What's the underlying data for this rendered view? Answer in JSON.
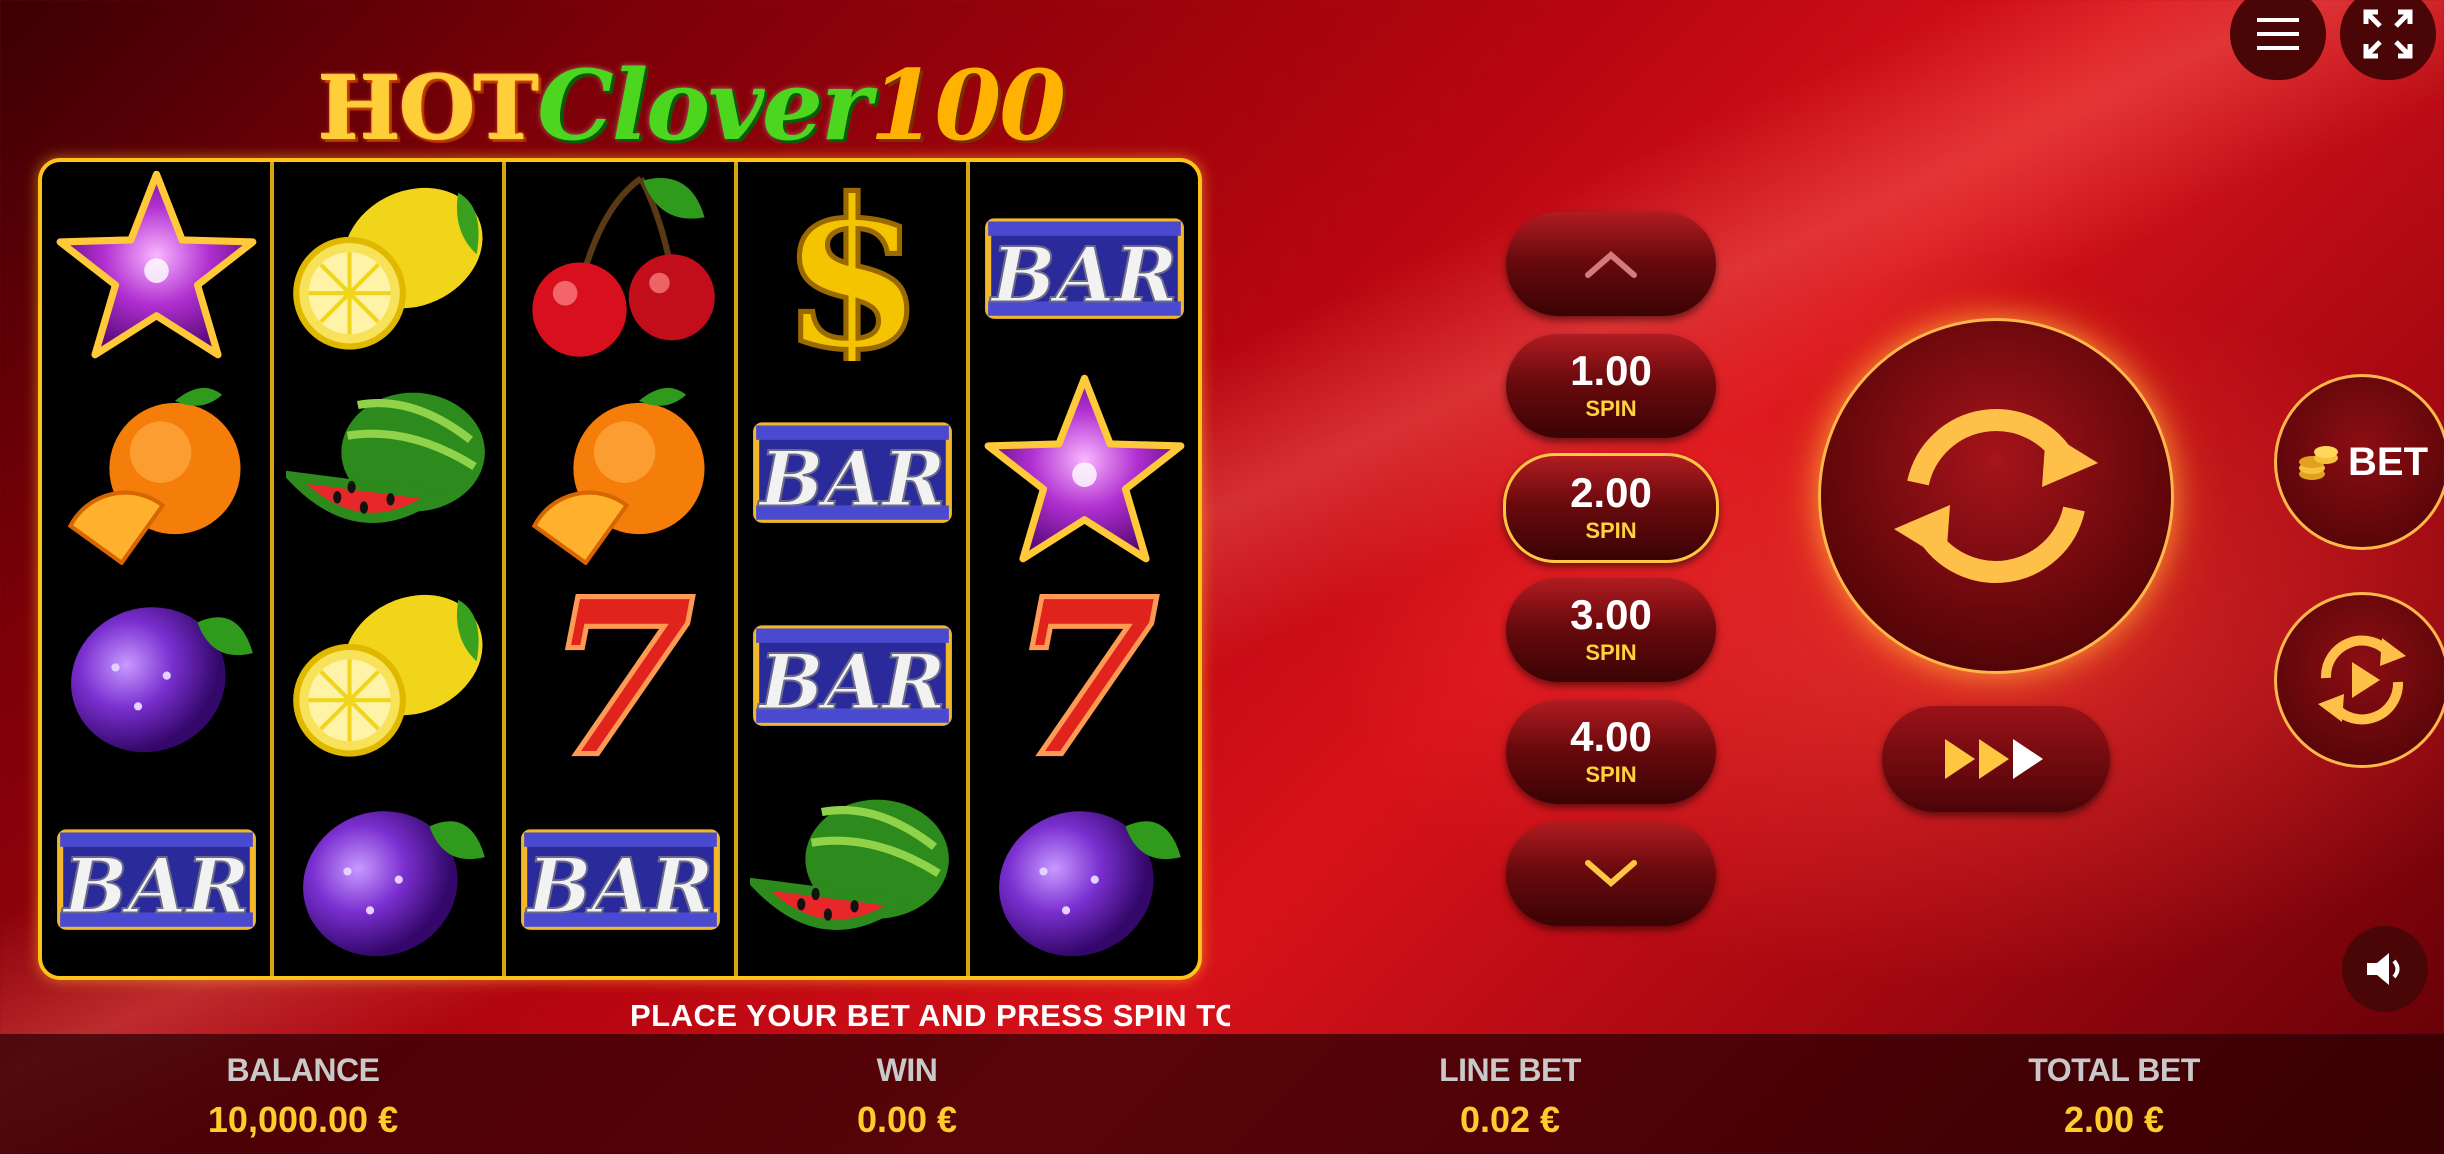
{
  "logo": {
    "hot": "HOT",
    "clover": "Clover",
    "num": "100"
  },
  "reels": [
    [
      "star",
      "orange",
      "plum",
      "bar"
    ],
    [
      "lemon",
      "watermelon",
      "lemon",
      "plum"
    ],
    [
      "cherry",
      "orange",
      "seven",
      "bar"
    ],
    [
      "dollar",
      "bar",
      "bar",
      "watermelon"
    ],
    [
      "bar",
      "star",
      "seven",
      "plum"
    ]
  ],
  "symbol_text": {
    "bar": "BAR",
    "dollar": "$",
    "seven": "7"
  },
  "bet_selector": {
    "options": [
      {
        "value": "1.00",
        "label": "SPIN"
      },
      {
        "value": "2.00",
        "label": "SPIN"
      },
      {
        "value": "3.00",
        "label": "SPIN"
      },
      {
        "value": "4.00",
        "label": "SPIN"
      }
    ],
    "selected": "2.00"
  },
  "controls": {
    "bet_label": "BET"
  },
  "message": "PLACE YOUR BET AND PRESS SPIN TO STAR",
  "stats": {
    "balance_label": "BALANCE",
    "balance": "10,000.00 €",
    "win_label": "WIN",
    "win": "0.00 €",
    "line_bet_label": "LINE BET",
    "line_bet": "0.02 €",
    "total_bet_label": "TOTAL BET",
    "total_bet": "2.00 €"
  },
  "colors": {
    "accent": "#ffc21a",
    "background": "#c30a12",
    "value_text": "#ffcc2e"
  }
}
